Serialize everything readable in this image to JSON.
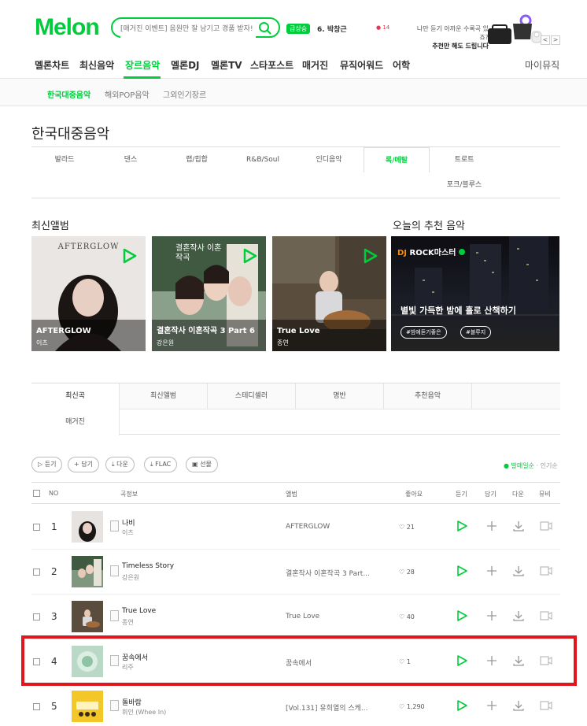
{
  "header": {
    "logo": "Melon",
    "search_placeholder": "[매거진 이벤트] 음원만 잘 남기고 경품 받자!",
    "rank_badge": "급상승",
    "rank_item": "6. 박창근",
    "rank_delta": "14",
    "promo_line1": "나만 듣기 아까운 수록곡 있죠?",
    "promo_line2": "추천만 해도 드립니다",
    "prev": "<",
    "next": ">"
  },
  "gnb": {
    "items": [
      "멜론차트",
      "최신음악",
      "장르음악",
      "멜론DJ",
      "멜론TV",
      "스타포스트",
      "매거진",
      "뮤직어워드",
      "어학"
    ],
    "active": "장르음악",
    "my_music": "마이뮤직"
  },
  "sub_nav": [
    "한국대중음악",
    "해외POP음악",
    "그외인기장르"
  ],
  "page_title": "한국대중음악",
  "genres": [
    "발라드",
    "댄스",
    "랩/힙합",
    "R&B/Soul",
    "인디음악",
    "록/메탈",
    "트로트",
    "포크/블루스"
  ],
  "active_genre": "록/메탈",
  "latest_albums": {
    "heading": "최신앨범",
    "items": [
      {
        "title": "AFTERGLOW",
        "artist": "이츠",
        "cover_text": "AFTERGLOW"
      },
      {
        "title": "결혼작사 이혼작곡 3 Part 6",
        "artist": "강은원",
        "cover_text": "결혼작사 이혼작곡"
      },
      {
        "title": "True Love",
        "artist": "종연"
      }
    ]
  },
  "recommend": {
    "heading": "오늘의 추천 음악",
    "dj_prefix": "DJ",
    "dj_name": "ROCK마스터",
    "title": "별빛 가득한 밤에 홀로 산책하기",
    "tags": [
      "#밤에듣기좋은",
      "#블루지"
    ]
  },
  "tabs": [
    "최신곡",
    "최신앨범",
    "스테디셀러",
    "명반",
    "추천음악",
    "매거진"
  ],
  "active_tab": "최신곡",
  "toolbar": {
    "listen": "듣기",
    "add": "담기",
    "download": "다운",
    "flac": "FLAC",
    "gift": "선물"
  },
  "sort": {
    "by_date": "발매일순",
    "by_popularity": "인기순"
  },
  "table": {
    "headers": {
      "no": "NO",
      "info": "곡정보",
      "album": "앨범",
      "like": "좋아요",
      "listen": "듣기",
      "add": "담기",
      "download": "다운",
      "mv": "뮤비"
    },
    "rows": [
      {
        "no": "1",
        "title": "나비",
        "artist": "이츠",
        "album": "AFTERGLOW",
        "likes": "21"
      },
      {
        "no": "2",
        "title": "Timeless Story",
        "artist": "강은원",
        "album": "결혼작사 이혼작곡 3 Part...",
        "likes": "28"
      },
      {
        "no": "3",
        "title": "True Love",
        "artist": "종연",
        "album": "True Love",
        "likes": "40"
      },
      {
        "no": "4",
        "title": "꿈속에서",
        "artist": "리주",
        "album": "꿈속에서",
        "likes": "1"
      },
      {
        "no": "5",
        "title": "돌바람",
        "artist": "휘인 (Whee In)",
        "album": "[Vol.131] 유희열의 스케...",
        "likes": "1,290"
      }
    ]
  },
  "colors": {
    "accent": "#00cd3c",
    "highlight": "#e0161e"
  }
}
